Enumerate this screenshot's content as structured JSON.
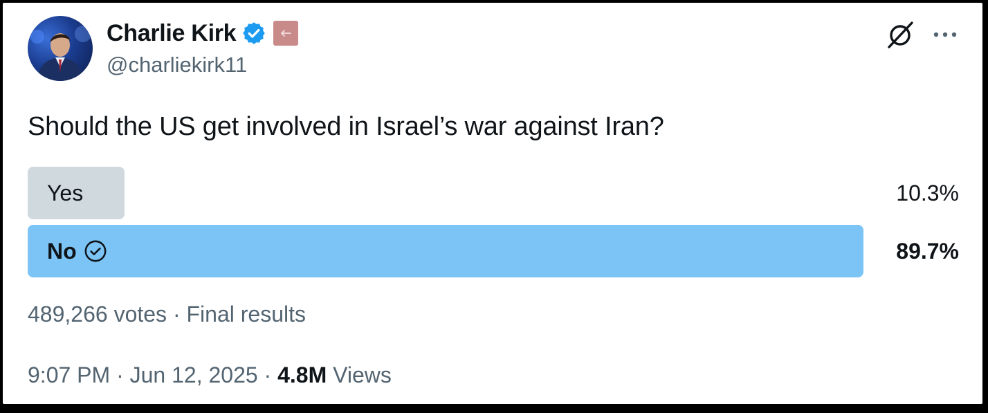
{
  "author": {
    "name": "Charlie Kirk",
    "handle": "@charliekirk11",
    "verified": true,
    "accent_color": "#1d9bf0"
  },
  "header_icons": [
    "grok-icon",
    "more-options-icon"
  ],
  "tweet": {
    "text": "Should the US get involved in Israel’s war against Iran?"
  },
  "poll": {
    "options": [
      {
        "label": "Yes",
        "percent_text": "10.3%",
        "percent": 10.3,
        "winner": false,
        "bar_color": "#cfd9de"
      },
      {
        "label": "No",
        "percent_text": "89.7%",
        "percent": 89.7,
        "winner": true,
        "bar_color": "#7cc4f5"
      }
    ],
    "votes": "489,266 votes",
    "separator": "·",
    "status": "Final results"
  },
  "meta": {
    "time": "9:07 PM",
    "separator": "·",
    "date": "Jun 12, 2025",
    "views_count": "4.8M",
    "views_label": "Views"
  }
}
